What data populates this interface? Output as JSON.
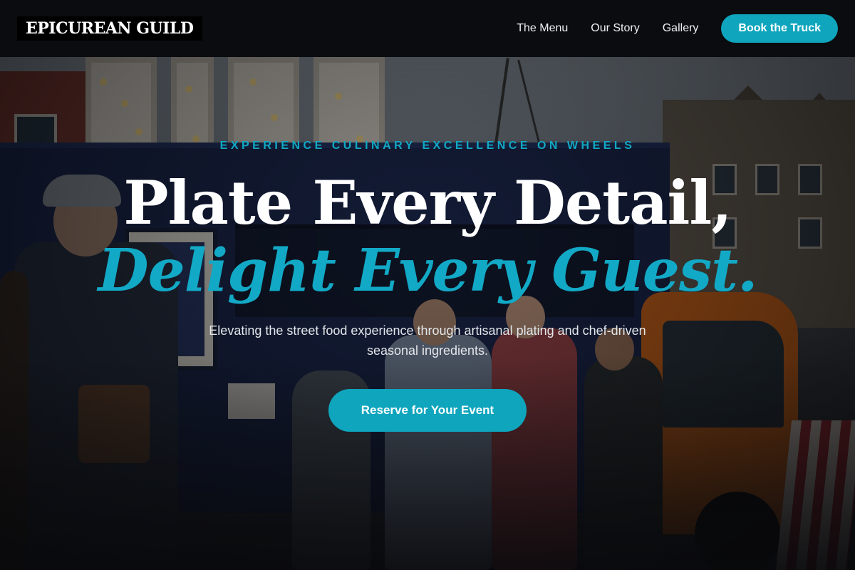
{
  "header": {
    "logo": "EPICUREAN GUILD",
    "nav": [
      {
        "label": "The Menu"
      },
      {
        "label": "Our Story"
      },
      {
        "label": "Gallery"
      }
    ],
    "cta_label": "Book the Truck"
  },
  "hero": {
    "eyebrow": "EXPERIENCE CULINARY EXCELLENCE ON WHEELS",
    "title_line1": "Plate Every Detail,",
    "title_line2": "Delight Every Guest.",
    "subtitle": "Elevating the street food experience through artisanal plating and chef-driven seasonal ingredients.",
    "cta_label": "Reserve for Your Event"
  },
  "colors": {
    "accent": "#0ea5bd",
    "header_bg": "#0a0c10",
    "text": "#ffffff"
  }
}
